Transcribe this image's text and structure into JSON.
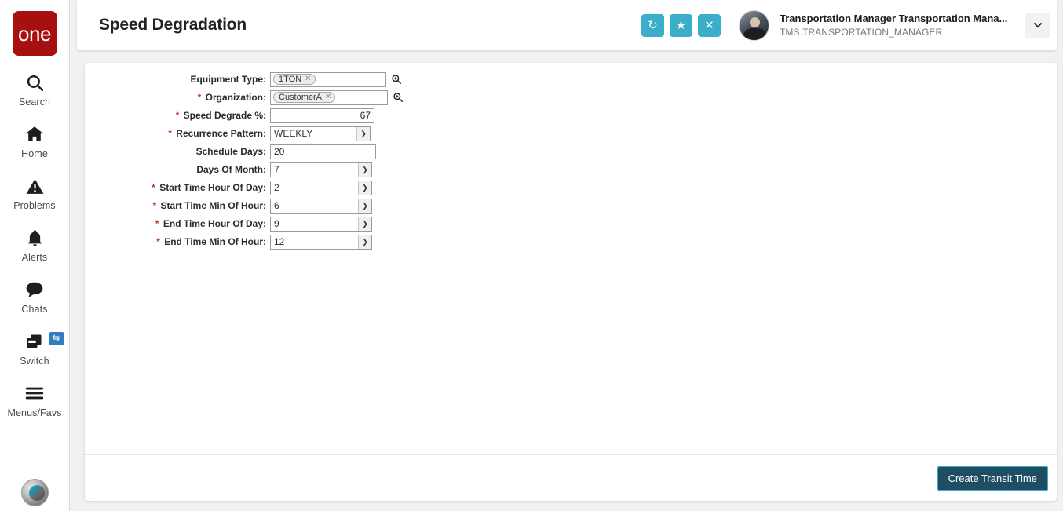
{
  "sidebar": {
    "logo_text": "one",
    "items": [
      {
        "label": "Search",
        "icon": "search-icon"
      },
      {
        "label": "Home",
        "icon": "home-icon"
      },
      {
        "label": "Problems",
        "icon": "warning-triangle-icon"
      },
      {
        "label": "Alerts",
        "icon": "bell-icon"
      },
      {
        "label": "Chats",
        "icon": "chat-bubble-icon"
      },
      {
        "label": "Switch",
        "icon": "switch-windows-icon",
        "badge_icon": "swap-arrows-icon"
      },
      {
        "label": "Menus/Favs",
        "icon": "hamburger-menu-icon"
      }
    ]
  },
  "header": {
    "title": "Speed Degradation",
    "actions": [
      {
        "name": "refresh-button",
        "glyph": "↻"
      },
      {
        "name": "favorite-button",
        "glyph": "★"
      },
      {
        "name": "close-button",
        "glyph": "✕"
      }
    ],
    "user": {
      "name": "Transportation Manager Transportation Mana...",
      "login": "TMS.TRANSPORTATION_MANAGER"
    },
    "caret_glyph": "❯"
  },
  "form": {
    "fields": [
      {
        "label": "Equipment Type:",
        "required": false,
        "type": "token",
        "chip": "1TON"
      },
      {
        "label": "Organization:",
        "required": true,
        "type": "token",
        "chip": "CustomerA"
      },
      {
        "label": "Speed Degrade %:",
        "required": true,
        "type": "number",
        "value": "67"
      },
      {
        "label": "Recurrence Pattern:",
        "required": true,
        "type": "select",
        "value": "WEEKLY"
      },
      {
        "label": "Schedule Days:",
        "required": false,
        "type": "text",
        "value": "20"
      },
      {
        "label": "Days Of Month:",
        "required": false,
        "type": "select",
        "value": "7"
      },
      {
        "label": "Start Time Hour Of Day:",
        "required": true,
        "type": "select",
        "value": "2"
      },
      {
        "label": "Start Time Min Of Hour:",
        "required": true,
        "type": "select",
        "value": "6"
      },
      {
        "label": "End Time Hour Of Day:",
        "required": true,
        "type": "select",
        "value": "9"
      },
      {
        "label": "End Time Min Of Hour:",
        "required": true,
        "type": "select",
        "value": "12"
      }
    ]
  },
  "footer": {
    "create_label": "Create Transit Time"
  },
  "colors": {
    "logo_red": "#a61010",
    "accent_teal": "#3bafc9",
    "button_navy": "#1f4e63",
    "required_red": "#c0392b",
    "badge_blue": "#2f7fc1"
  }
}
